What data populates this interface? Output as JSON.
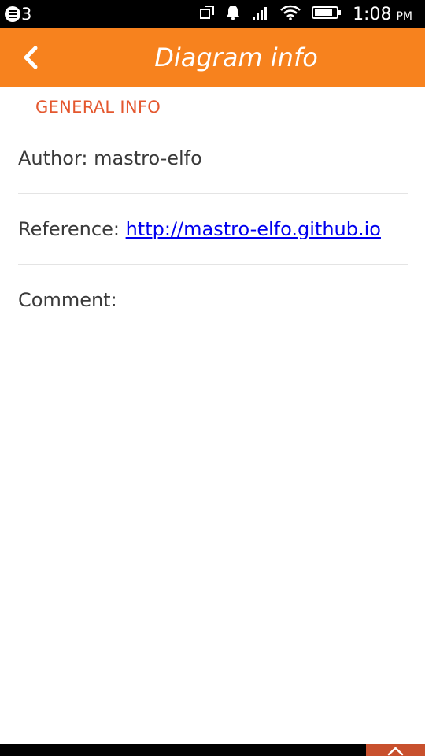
{
  "status_bar": {
    "notification_count": "3",
    "time": "1:08",
    "ampm": "PM",
    "icons": [
      "notification-icon",
      "copy-icon",
      "alarm-bell-icon",
      "cell-signal-icon",
      "wifi-icon",
      "battery-icon"
    ]
  },
  "header": {
    "title": "Diagram info",
    "back_icon": "chevron-left-icon",
    "color": "#f7821e"
  },
  "general_info": {
    "section_title": "GENERAL INFO",
    "author_label": "Author:",
    "author_value": "mastro-elfo",
    "reference_label": "Reference:",
    "reference_link": "http://mastro-elfo.github.io",
    "comment_label": "Comment:",
    "comment_value": ""
  },
  "bottom_bar": {
    "expand_icon": "chevron-up-icon"
  },
  "colors": {
    "accent": "#f7821e",
    "section_title": "#e4572e",
    "link": "#0000ee",
    "expand_button": "#c8502d"
  }
}
